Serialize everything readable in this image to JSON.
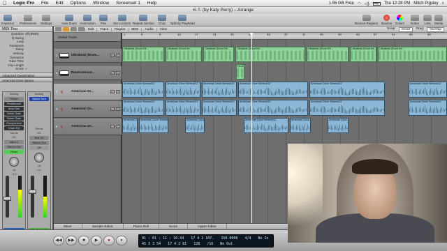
{
  "menubar": {
    "apple_glyph": "",
    "app": "Logic Pro",
    "items": [
      "File",
      "Edit",
      "Options",
      "Window",
      "Screenset 1",
      "Help"
    ],
    "disk": "1.55 GB Free",
    "clock": "Thu 12:28 PM",
    "user": "Mitch Pigsley"
  },
  "window": {
    "title": "E.T. (by Katy Perry) – Arrange"
  },
  "toolbar": {
    "left": [
      "Inspector",
      "Preferences",
      "Settings",
      "Auto Zoom",
      "Automation",
      "Flex",
      "Set Locators",
      "Repeat Section",
      "Crop",
      "Split by Playhead"
    ],
    "right": [
      "Bounce Regions",
      "Bounce",
      "Colors",
      "Notes",
      "Lists",
      "Media"
    ]
  },
  "inspector": {
    "header": "MIDI Thru",
    "params": [
      {
        "k": "Quantize",
        "v": "off (3840)"
      },
      {
        "k": "Q-Swing",
        "v": ""
      },
      {
        "k": "Loop",
        "v": ""
      },
      {
        "k": "Transpose",
        "v": ""
      },
      {
        "k": "Delay",
        "v": ""
      },
      {
        "k": "Velocity",
        "v": ""
      },
      {
        "k": "Dynamics",
        "v": ""
      },
      {
        "k": "Gate Time",
        "v": ""
      },
      {
        "k": "Clip Length",
        "v": ""
      },
      {
        "k": "Score",
        "v": "✓"
      }
    ],
    "adv": "Advanced Quantization",
    "track": "American Drive Stereo",
    "strip1": {
      "setting_label": "Setting",
      "setting": "Preset",
      "plugins": [
        "Pedalboard",
        "Amp Des",
        "Noise Gate",
        "Noise Gate",
        "Compressor",
        "Chan EQ"
      ],
      "sends_label": "Sends",
      "io_label": "I/O",
      "input": "Input 1",
      "output": "Stereo Out",
      "read": "Read",
      "pan_value": "-41",
      "fader_value": "-3.2",
      "name": "American"
    },
    "strip2": {
      "setting_label": "Setting",
      "setting": "Space Des",
      "sends_label": "Sends",
      "io_label": "I/O",
      "input": "Bus 10",
      "output": "Stereo Out",
      "read": "Off",
      "pan_value": "-41",
      "fader_value": "0.0",
      "name": "GuitLeft"
    }
  },
  "arrange_bar": {
    "menus": [
      "Edit",
      "Track",
      "Region",
      "MIDI",
      "Audio",
      "View"
    ],
    "snap_label": "Snap:",
    "snap": "Smart",
    "drag_label": "Drag:",
    "drag": "Overlap"
  },
  "global_tracks": "Global Tracks",
  "tracks": [
    {
      "num": "1",
      "name": "Ultrabeat (Drum...",
      "type": "keys"
    },
    {
      "num": "2",
      "name": "ReverseGuar...",
      "type": "keys"
    },
    {
      "num": "3",
      "name": "American Dr...",
      "type": "guitar"
    },
    {
      "num": "4",
      "name": "American Dr...",
      "type": "guitar"
    },
    {
      "num": "5",
      "name": "American Dr...",
      "type": "guitar"
    }
  ],
  "ruler": [
    "1",
    "5",
    "9",
    "13",
    "17",
    "21",
    "25",
    "29",
    "33",
    "37",
    "41",
    "45",
    "49",
    "53",
    "57",
    "61",
    "65",
    "69"
  ],
  "region_names": {
    "ultrabeat": "Ultrabeat (Drum Kit...",
    "reverse": "Rever",
    "american": "American Drive Stereo#12"
  },
  "bottom_tabs": [
    "Mixer",
    "Sample Editor",
    "Piano Roll",
    "Score",
    "Hyper Editor"
  ],
  "transport": {
    "buttons": [
      "◀◀",
      "▶▶",
      "■",
      "▶",
      "●",
      "⏸"
    ],
    "smpte": "01 : 01 : 11 : 10.44",
    "bars": "45   3   3   54",
    "pos_row1": "17   4   2   107.",
    "pos_row2": "17   4   2   81",
    "tempo": "150.0000",
    "tempo2": "128",
    "sig_row1": "4/4",
    "sig_row2": "/16",
    "in_label": "No In",
    "out_label": "No Out"
  }
}
